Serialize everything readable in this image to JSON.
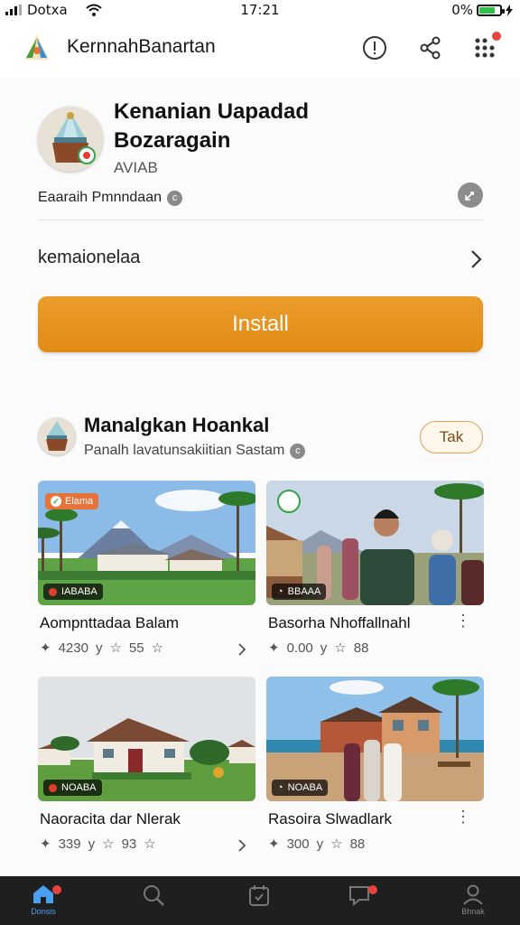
{
  "status_bar": {
    "carrier": "Dotxa",
    "time": "17:21",
    "battery": "0%",
    "battery_level": 0.7
  },
  "app_bar": {
    "title": "KernnahBanartan"
  },
  "app": {
    "name": "Kenanian Uapadad Bozaragain",
    "subtitle": "AVIAB",
    "developer": "Eaaraih Pmnndaan",
    "details_link": "kemaionelaa",
    "install_label": "Install"
  },
  "section": {
    "title": "Manalgkan Hoankal",
    "subtitle": "Panalh lavatunsakiitian Sastam",
    "pill_label": "Tak"
  },
  "cards": [
    {
      "title": "Aompnttadaa Balam",
      "tag": "Elama",
      "label": "IABABA",
      "downloads": "4230",
      "rating": "55"
    },
    {
      "title": "Basorha Nhoffallnahl",
      "tag": "",
      "label": "BBAAA",
      "downloads": "0.00",
      "rating": "88"
    },
    {
      "title": "Naoracita dar Nlerak",
      "tag": "",
      "label": "NOABA",
      "downloads": "339",
      "rating": "93"
    },
    {
      "title": "Rasoira Slwadlark",
      "tag": "",
      "label": "NOABA",
      "downloads": "300",
      "rating": "88"
    }
  ],
  "tab_bar": {
    "home_label": "Donsis",
    "profile_label": "Bhnak"
  },
  "colors": {
    "accent": "#e28b17",
    "notification": "#e5433b",
    "battery": "#2fc24a"
  }
}
